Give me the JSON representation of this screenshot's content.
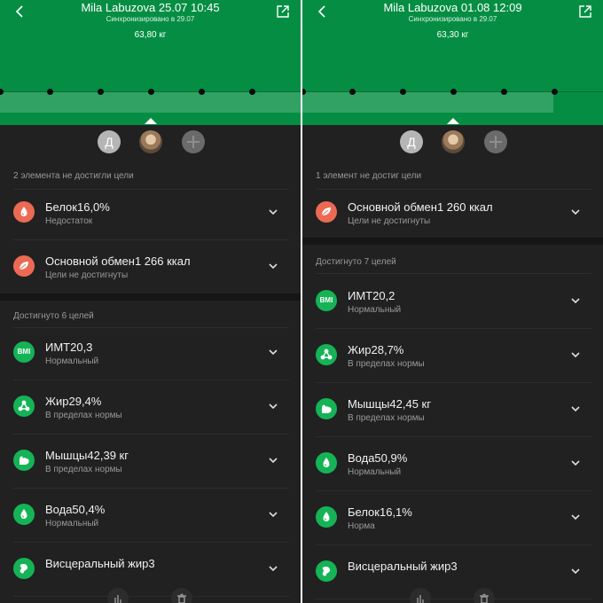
{
  "screens": [
    {
      "title": "Mila Labuzova 25.07 10:45",
      "sync": "Синхронизировано в 29.07",
      "weight": "63,80  кг",
      "avatar_letter": "Д",
      "section1": "2 элемента не достигли цели",
      "section2": "Достигнуто 6 целей",
      "items1": [
        {
          "name": "Белок16,0%",
          "status": "Недостаток",
          "icon": "drop-icon",
          "color": "#ec6a54"
        },
        {
          "name": "Основной обмен1 266 ккал",
          "status": "Цели не достигнуты",
          "icon": "leaf-icon",
          "color": "#ec6a54"
        }
      ],
      "items2": [
        {
          "name": "ИМТ20,3",
          "status": "Нормальный",
          "icon": "bmi-icon",
          "icon_text": "BMI",
          "color": "#15b356"
        },
        {
          "name": "Жир29,4%",
          "status": "В пределах нормы",
          "icon": "fat-molecule-icon",
          "color": "#15b356"
        },
        {
          "name": "Мышцы42,39 кг",
          "status": "В пределах нормы",
          "icon": "muscle-icon",
          "color": "#15b356"
        },
        {
          "name": "Вода50,4%",
          "status": "Нормальный",
          "icon": "water-drop-icon",
          "color": "#15b356"
        },
        {
          "name": "Висцеральный жир3",
          "status": "",
          "icon": "visceral-fat-icon",
          "color": "#15b356"
        }
      ]
    },
    {
      "title": "Mila Labuzova 01.08 12:09",
      "sync": "Синхронизировано в 29.07",
      "weight": "63,30  кг",
      "avatar_letter": "Д",
      "section1": "1 элемент не достиг цели",
      "section2": "Достигнуто 7 целей",
      "items1": [
        {
          "name": "Основной обмен1 260 ккал",
          "status": "Цели не достигнуты",
          "icon": "leaf-icon",
          "color": "#ec6a54"
        }
      ],
      "items2": [
        {
          "name": "ИМТ20,2",
          "status": "Нормальный",
          "icon": "bmi-icon",
          "icon_text": "BMI",
          "color": "#15b356"
        },
        {
          "name": "Жир28,7%",
          "status": "В пределах нормы",
          "icon": "fat-molecule-icon",
          "color": "#15b356"
        },
        {
          "name": "Мышцы42,45 кг",
          "status": "В пределах нормы",
          "icon": "muscle-icon",
          "color": "#15b356"
        },
        {
          "name": "Вода50,9%",
          "status": "Нормальный",
          "icon": "water-drop-icon",
          "color": "#15b356"
        },
        {
          "name": "Белок16,1%",
          "status": "Норма",
          "icon": "drop-icon",
          "color": "#15b356"
        },
        {
          "name": "Висцеральный жир3",
          "status": "",
          "icon": "visceral-fat-icon",
          "color": "#15b356"
        }
      ]
    }
  ],
  "colors": {
    "header_green": "#058e43",
    "background": "#212121",
    "warning_red": "#ec6a54",
    "ok_green": "#15b356"
  },
  "bottom_icons": [
    "chart-icon",
    "trash-icon"
  ]
}
